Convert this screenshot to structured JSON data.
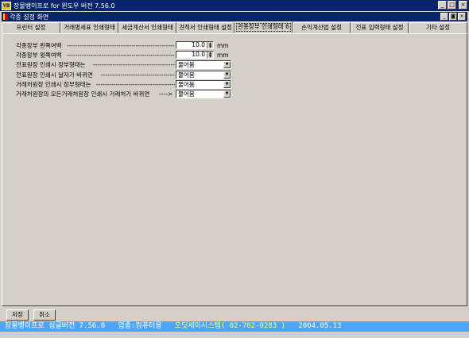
{
  "window": {
    "title": "장물뱅이프로 for 윈도우 버전 7.56.0",
    "icon_text": "YB",
    "minimize": "_",
    "maximize": "□",
    "close": "×"
  },
  "mdi": {
    "title": "각종 설정 화면",
    "minimize": "_",
    "restore": "◙",
    "close": "×"
  },
  "tabs": [
    "프린터 설정",
    "거래명세표 인쇄형태",
    "세금계산서 인쇄형태",
    "견적서 인쇄형태 설정",
    "관종장부 인쇄형태 6",
    "손익계산법 설정",
    "전표 입력형태 설정",
    "기타 설정"
  ],
  "active_tab": 4,
  "settings": {
    "rows": [
      {
        "label": "각종장부 왼쪽여백",
        "arrow": "--------------------------------------------------------->",
        "type": "spin",
        "value": "10.0",
        "unit": "mm"
      },
      {
        "label": "각종장부 윗쪽여백",
        "arrow": "--------------------------------------------------------->",
        "type": "spin",
        "value": "10.0",
        "unit": "mm"
      },
      {
        "label": "전표원장 인쇄시 장부형태는",
        "arrow": "------------------------------------------>",
        "type": "combo",
        "value": "물어봄"
      },
      {
        "label": "전표원장 인쇄시 날자가 바뀌면",
        "arrow": "------------------------------------>",
        "type": "combo",
        "value": "물어봄"
      },
      {
        "label": "거래처원장 인쇄시 장부형태는",
        "arrow": "--------------------------------------->",
        "type": "combo",
        "value": "물어봄"
      },
      {
        "label": "거래처원장의 모든거래처원장 인쇄시 거래처가 바뀌면",
        "arrow": "---->",
        "type": "combo",
        "value": "물어봄"
      }
    ]
  },
  "buttons": {
    "save": "저장",
    "cancel": "취소"
  },
  "status": {
    "product": "장물뱅이프로 싱글버전 7.56.0",
    "business": "업종:컴퓨터용",
    "company": "오딧세이시스템( 02-702-0283 )",
    "date": "2004.05.13"
  }
}
